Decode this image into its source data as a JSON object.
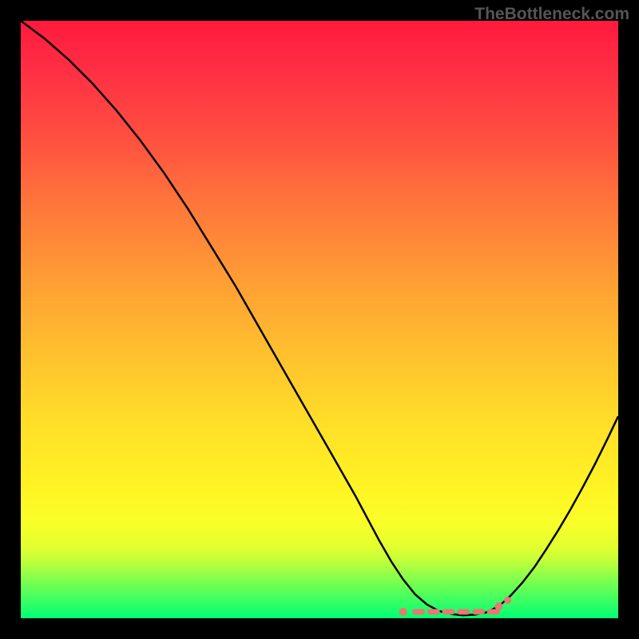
{
  "watermark": "TheBottleneck.com",
  "colors": {
    "curve": "#000000",
    "marker": "#e87870",
    "border": "#000000"
  },
  "chart_data": {
    "type": "line",
    "title": "",
    "xlabel": "",
    "ylabel": "",
    "xlim": [
      0,
      100
    ],
    "ylim": [
      0,
      100
    ],
    "grid": false,
    "description": "Bottleneck curve: a steep descending line from top-left that reaches a near-zero flat region around x≈65-80, then rises again toward the right. A small red dotted/dashed marker sits along the flat bottom indicating the optimal (no-bottleneck) zone.",
    "series": [
      {
        "name": "curve",
        "x": [
          0,
          4,
          8,
          12,
          16,
          20,
          24,
          28,
          32,
          36,
          40,
          44,
          48,
          52,
          56,
          60,
          62,
          64,
          66,
          68,
          70,
          72,
          74,
          76,
          78,
          80,
          82,
          84,
          86,
          88,
          90,
          92,
          94,
          96,
          98,
          100
        ],
        "y": [
          100,
          97,
          93.5,
          89.5,
          85,
          80,
          74.5,
          68.5,
          62,
          55.5,
          48.5,
          41.5,
          34.5,
          27.5,
          20.5,
          13,
          9.5,
          6.5,
          4,
          2.3,
          1.2,
          0.7,
          0.5,
          0.6,
          1,
          2,
          3.8,
          6,
          8.6,
          11.6,
          14.8,
          18.2,
          21.8,
          25.6,
          29.6,
          33.8
        ]
      }
    ],
    "flat_region": {
      "x_start": 64,
      "x_end": 80,
      "y": 0.8
    }
  }
}
